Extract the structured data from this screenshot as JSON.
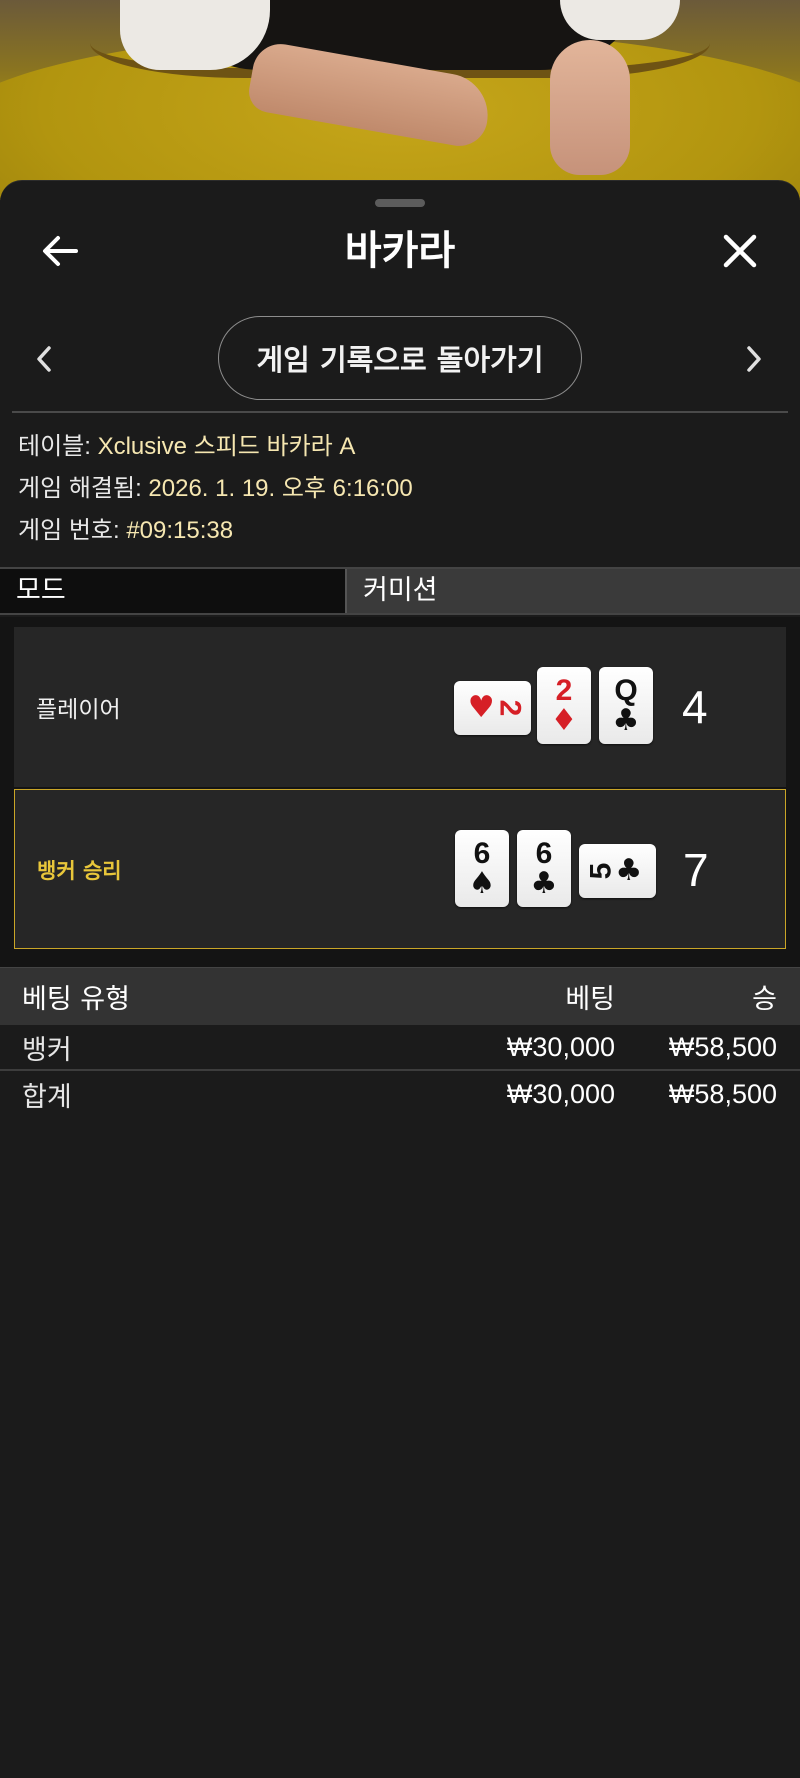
{
  "header": {
    "title": "바카라"
  },
  "nav": {
    "back_to_history": "게임 기록으로 돌아가기"
  },
  "info": {
    "table_label": "테이블: ",
    "table_value": "Xclusive 스피드 바카라 A",
    "resolved_label": "게임 해결됨: ",
    "resolved_value": "2026. 1. 19. 오후 6:16:00",
    "number_label": "게임 번호: ",
    "number_value": "#09:15:38"
  },
  "mode": {
    "col1": "모드",
    "col2": "커미션"
  },
  "results": {
    "player": {
      "label": "플레이어",
      "score": "4",
      "cards": [
        {
          "rank": "2",
          "suit": "♥",
          "color": "#d61f26",
          "orientation": "horizontal"
        },
        {
          "rank": "2",
          "suit": "♦",
          "color": "#d61f26",
          "orientation": "vertical"
        },
        {
          "rank": "Q",
          "suit": "♣",
          "color": "#111111",
          "orientation": "vertical"
        }
      ]
    },
    "banker": {
      "label": "뱅커 승리",
      "score": "7",
      "cards": [
        {
          "rank": "6",
          "suit": "♠",
          "color": "#111111",
          "orientation": "vertical"
        },
        {
          "rank": "6",
          "suit": "♣",
          "color": "#111111",
          "orientation": "vertical"
        },
        {
          "rank": "5",
          "suit": "♣",
          "color": "#111111",
          "orientation": "horizontal"
        }
      ]
    }
  },
  "bets": {
    "headers": {
      "type": "베팅 유형",
      "bet": "베팅",
      "win": "승"
    },
    "rows": [
      {
        "type": "뱅커",
        "bet": "₩30,000",
        "win": "₩58,500"
      }
    ],
    "total": {
      "type": "합계",
      "bet": "₩30,000",
      "win": "₩58,500"
    }
  },
  "colors": {
    "accent_gold": "#c9a527",
    "info_value": "#f6e7b1",
    "background": "#1b1b1b"
  }
}
